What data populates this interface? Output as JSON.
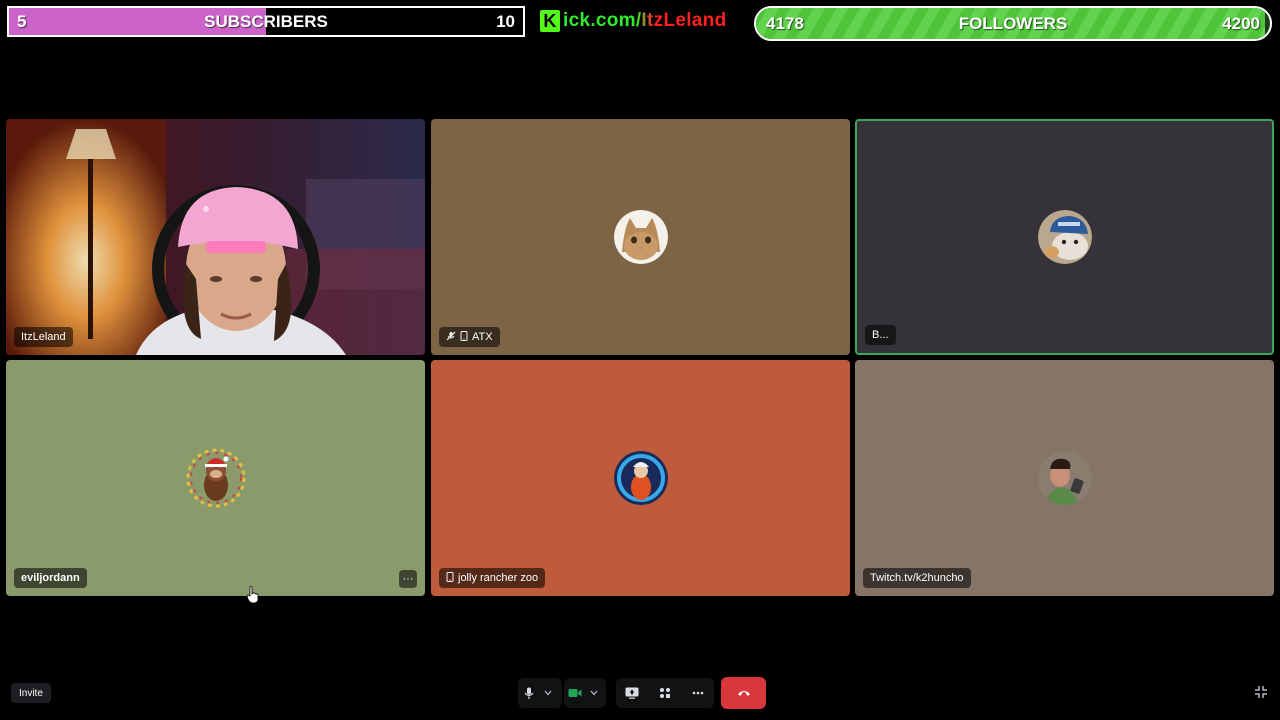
{
  "overlay": {
    "subscribers": {
      "current": "5",
      "label": "SUBSCRIBERS",
      "goal": "10",
      "progress": 0.5,
      "color": "#cc63c8"
    },
    "kick_link": {
      "logo": "K",
      "text": "ick.com/ItzLeland"
    },
    "followers": {
      "current": "4178",
      "label": "FOLLOWERS",
      "goal": "4200",
      "progress": 0.99,
      "color": "#4fc43a"
    }
  },
  "tiles": [
    {
      "name": "ItzLeland",
      "type": "video"
    },
    {
      "name": "ATX",
      "bg": "#7d6445",
      "icons": [
        "mic-muted-icon",
        "mobile-icon"
      ],
      "avatar": "cat-avatar"
    },
    {
      "name": "B...",
      "bg": "#353238",
      "active": true,
      "avatar": "cat-with-cap-avatar"
    },
    {
      "name": "eviljordann",
      "bg": "#8a9a6a",
      "avatar": "monkey-santa-avatar",
      "more": "···"
    },
    {
      "name": "jolly rancher zoo",
      "bg": "#bd5b3a",
      "icons": [
        "mobile-icon"
      ],
      "avatar": "character-avatar"
    },
    {
      "name": "Twitch.tv/k2huncho",
      "bg": "#857468",
      "avatar": "person-avatar"
    }
  ],
  "controls": {
    "invite_label": "Invite",
    "buttons": [
      "microphone-icon",
      "camera-icon",
      "screen-share-icon",
      "activities-icon",
      "more-icon",
      "end-call-icon"
    ],
    "camera_on_color": "#23a55a",
    "end_call_color": "#da373c"
  }
}
